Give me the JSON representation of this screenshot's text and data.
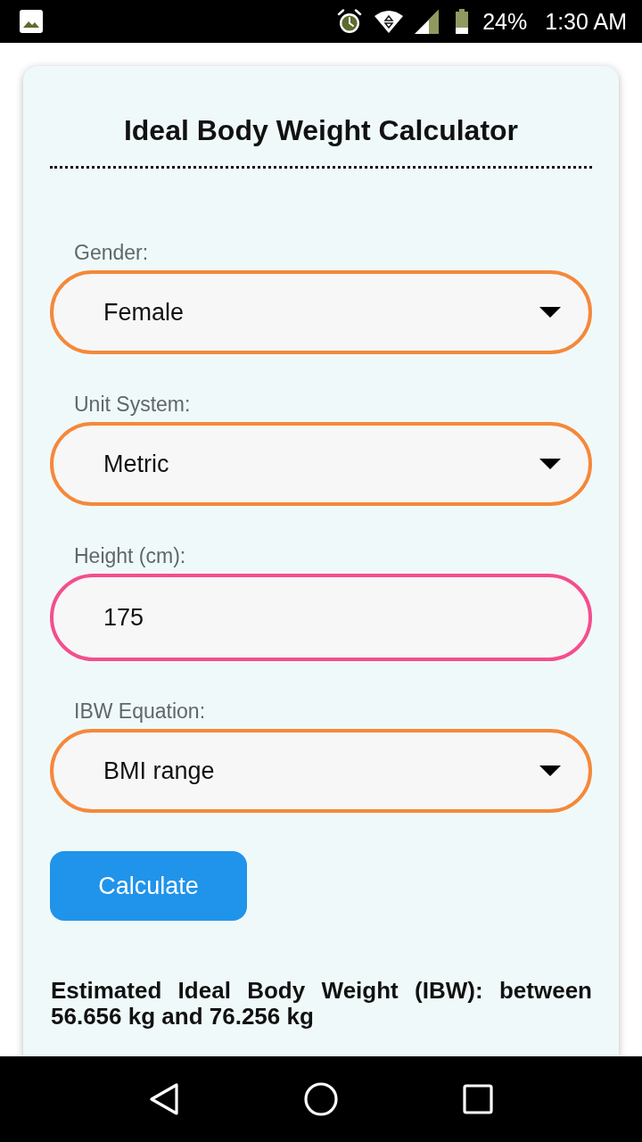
{
  "status_bar": {
    "battery": "24%",
    "time": "1:30 AM"
  },
  "card": {
    "title": "Ideal Body Weight Calculator",
    "fields": [
      {
        "kind": "select",
        "label": "Gender:",
        "value": "Female"
      },
      {
        "kind": "select",
        "label": "Unit System:",
        "value": "Metric"
      },
      {
        "kind": "input",
        "label": "Height (cm):",
        "value": "175"
      },
      {
        "kind": "select",
        "label": "IBW Equation:",
        "value": "BMI range"
      }
    ],
    "button": "Calculate",
    "result": "Estimated Ideal Body Weight (IBW): between 56.656 kg and 76.256 kg"
  }
}
